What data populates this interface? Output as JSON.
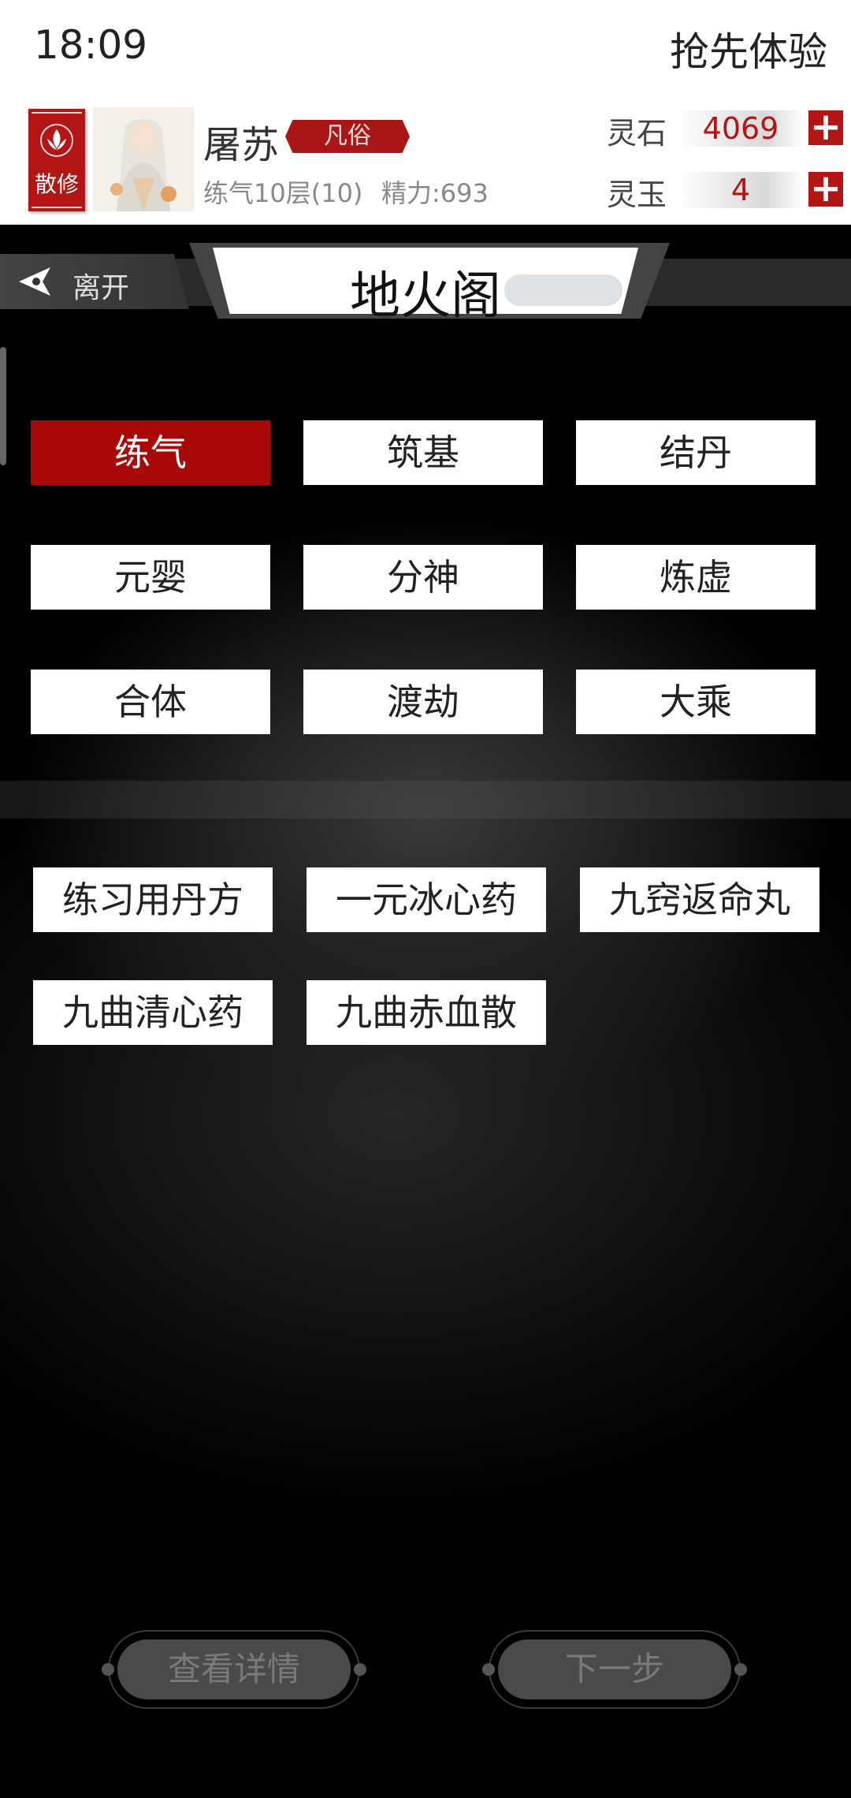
{
  "status_bar": {
    "time": "18:09",
    "right_text": "抢先体验"
  },
  "profile": {
    "sect_label": "散修",
    "name": "屠苏",
    "rank": "凡俗",
    "level": "练气10层(10)",
    "energy": "精力:693",
    "resources": [
      {
        "label": "灵石",
        "value": "4069"
      },
      {
        "label": "灵玉",
        "value": "4"
      }
    ]
  },
  "title_bar": {
    "leave_label": "离开",
    "page_title": "地火阁"
  },
  "realms": {
    "selected": "练气",
    "items": [
      "练气",
      "筑基",
      "结丹",
      "元婴",
      "分神",
      "炼虚",
      "合体",
      "渡劫",
      "大乘"
    ]
  },
  "recipes": [
    "练习用丹方",
    "一元冰心药",
    "九窍返命丸",
    "九曲清心药",
    "九曲赤血散"
  ],
  "bottom": {
    "details_label": "查看详情",
    "next_label": "下一步"
  },
  "colors": {
    "accent_red": "#a80808",
    "button_white": "#ffffff",
    "background": "#000000"
  }
}
